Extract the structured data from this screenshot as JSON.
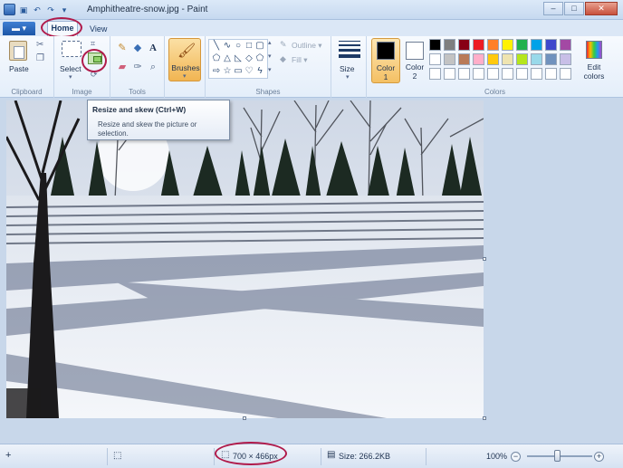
{
  "window": {
    "title": "Amphitheatre-snow.jpg - Paint",
    "minimize": "–",
    "maximize": "□",
    "close": "✕"
  },
  "tabs": {
    "file": "▬ ▾",
    "home": "Home",
    "view": "View"
  },
  "ribbon": {
    "clipboard": {
      "paste": "Paste",
      "label": "Clipboard"
    },
    "image": {
      "select": "Select",
      "label": "Image"
    },
    "tools": {
      "label": "Tools"
    },
    "brushes": "Brushes",
    "shapes": {
      "outline": "Outline ▾",
      "fill": "Fill ▾",
      "label": "Shapes"
    },
    "size": "Size",
    "colors": {
      "color1_line1": "Color",
      "color1_line2": "1",
      "color2_line1": "Color",
      "color2_line2": "2",
      "edit_line1": "Edit",
      "edit_line2": "colors",
      "label": "Colors",
      "palette_row1": [
        "#000000",
        "#7f7f7f",
        "#880015",
        "#ed1c24",
        "#ff7f27",
        "#fff200",
        "#22b14c",
        "#00a2e8",
        "#3f48cc",
        "#a349a4"
      ],
      "palette_row2": [
        "#ffffff",
        "#c3c3c3",
        "#b97a57",
        "#ffaec9",
        "#ffc90e",
        "#efe4b0",
        "#b5e61d",
        "#99d9ea",
        "#7092be",
        "#c8bfe7"
      ],
      "palette_row3": [
        "#ffffff",
        "#ffffff",
        "#ffffff",
        "#ffffff",
        "#ffffff",
        "#ffffff",
        "#ffffff",
        "#ffffff",
        "#ffffff",
        "#ffffff"
      ]
    }
  },
  "tooltip": {
    "title": "Resize and skew (Ctrl+W)",
    "desc_line1": "Resize and skew the picture or",
    "desc_line2": "selection."
  },
  "statusbar": {
    "add": "+",
    "dimensions": "700 × 466px",
    "size": "Size: 266.2KB",
    "zoom": "100%",
    "zoom_out": "−",
    "zoom_in": "+"
  },
  "highlight_color": "#b01a4a"
}
